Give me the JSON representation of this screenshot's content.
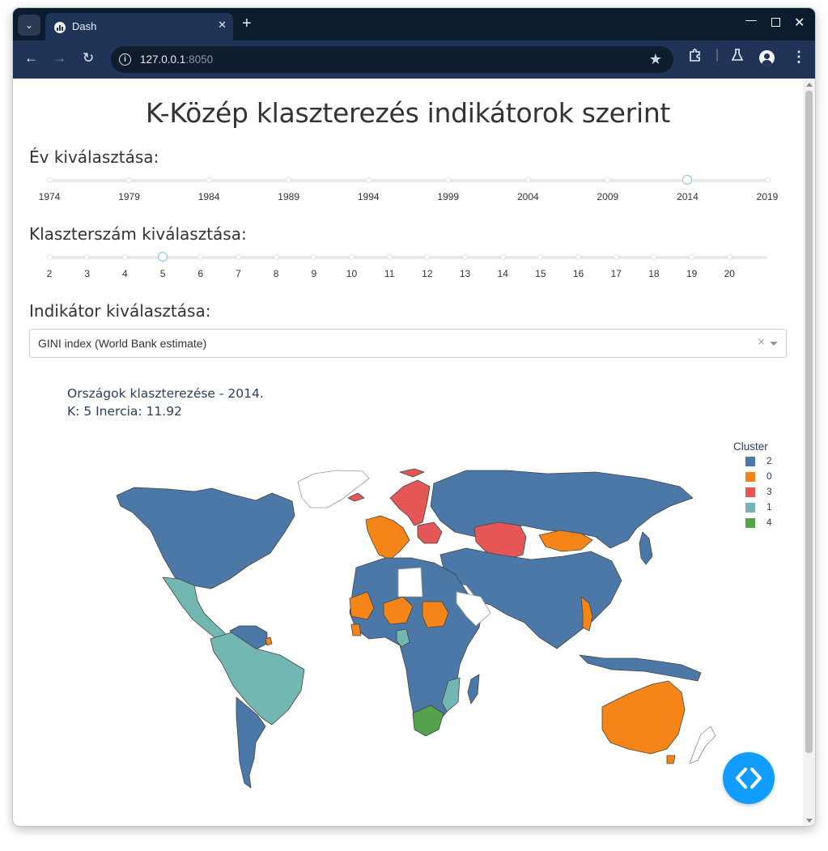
{
  "browser": {
    "tab_title": "Dash",
    "url_host": "127.0.0.1",
    "url_port": ":8050"
  },
  "page": {
    "title": "K-Közép klaszterezés indikátorok szerint"
  },
  "year_slider": {
    "label": "Év kiválasztása:",
    "marks": [
      "1974",
      "1979",
      "1984",
      "1989",
      "1994",
      "1999",
      "2004",
      "2009",
      "2014",
      "2019"
    ],
    "min": 1974,
    "max": 2019,
    "value": 2014
  },
  "cluster_slider": {
    "label": "Klaszterszám kiválasztása:",
    "marks": [
      "2",
      "3",
      "4",
      "5",
      "6",
      "7",
      "8",
      "9",
      "10",
      "11",
      "12",
      "13",
      "14",
      "15",
      "16",
      "17",
      "18",
      "19",
      "20"
    ],
    "min": 2,
    "max": 21,
    "value": 5
  },
  "indicator": {
    "label": "Indikátor kiválasztása:",
    "selected": "GINI index (World Bank estimate)",
    "clear_icon": "clear-icon",
    "arrow_icon": "chevron-down-icon"
  },
  "map": {
    "title_line1": "Országok klaszterezése - 2014.",
    "title_line2": "K: 5 Inercia: 11.92",
    "legend_title": "Cluster",
    "legend": [
      {
        "label": "2",
        "color": "#4c78a8"
      },
      {
        "label": "0",
        "color": "#f58518"
      },
      {
        "label": "3",
        "color": "#e45756"
      },
      {
        "label": "1",
        "color": "#72b7b2"
      },
      {
        "label": "4",
        "color": "#54a24b"
      }
    ]
  },
  "colors": {
    "tabbar": "#0d1b2e",
    "toolbar": "#1f3456",
    "accent": "#119dff"
  }
}
